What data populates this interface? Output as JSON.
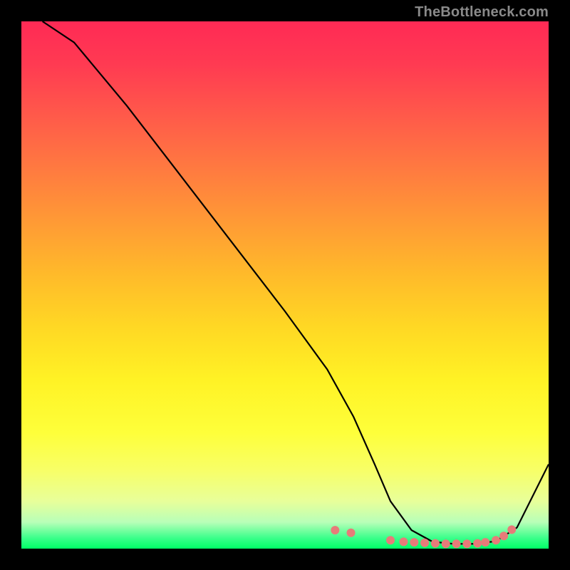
{
  "watermark": "TheBottleneck.com",
  "chart_data": {
    "type": "line",
    "title": "",
    "xlabel": "",
    "ylabel": "",
    "xlim": [
      0,
      100
    ],
    "ylim": [
      0,
      100
    ],
    "series": [
      {
        "name": "curve",
        "x": [
          4,
          10,
          20,
          30,
          40,
          50,
          58,
          63,
          67,
          70,
          74,
          78,
          82,
          86,
          90,
          94,
          100
        ],
        "y": [
          100,
          96,
          84,
          71,
          58,
          45,
          34,
          25,
          16,
          9,
          3.5,
          1.3,
          0.9,
          0.9,
          1.4,
          4,
          16
        ]
      },
      {
        "name": "dots",
        "x": [
          59.5,
          62.5,
          70,
          72.5,
          74.5,
          76.5,
          78.5,
          80.5,
          82.5,
          84.5,
          86.5,
          88,
          90,
          91.5,
          93
        ],
        "y": [
          3.5,
          3.0,
          1.6,
          1.3,
          1.2,
          1.1,
          1.0,
          0.9,
          0.9,
          0.9,
          1.0,
          1.2,
          1.6,
          2.4,
          3.6
        ]
      }
    ],
    "background": "red-yellow-green-gradient",
    "curve_color": "#000000",
    "dot_color": "#e77b79"
  }
}
